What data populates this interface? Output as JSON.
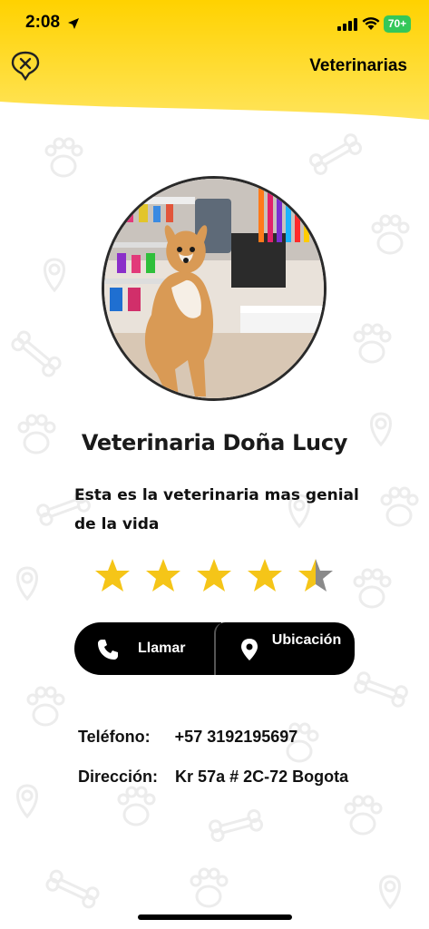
{
  "status_bar": {
    "time": "2:08",
    "battery": "70+"
  },
  "header": {
    "title": "Veterinarias",
    "close_icon": "close-x-icon",
    "gradient_top": "#ffd400",
    "gradient_bottom": "#ffe44d"
  },
  "profile": {
    "name": "Veterinaria Doña Lucy",
    "description": "Esta es la veterinaria mas genial de la vida",
    "rating": 4.5,
    "rating_max": 5,
    "star_color": "#f5c518",
    "star_empty_color": "#8a8a8a"
  },
  "actions": {
    "call_label": "Llamar",
    "call_icon": "phone-icon",
    "location_label": "Ubicación",
    "location_icon": "map-pin-icon"
  },
  "contact": {
    "phone_label": "Teléfono:",
    "phone_value": "+57 3192195697",
    "address_label": "Dirección:",
    "address_value": "Kr 57a # 2C-72 Bogota"
  }
}
